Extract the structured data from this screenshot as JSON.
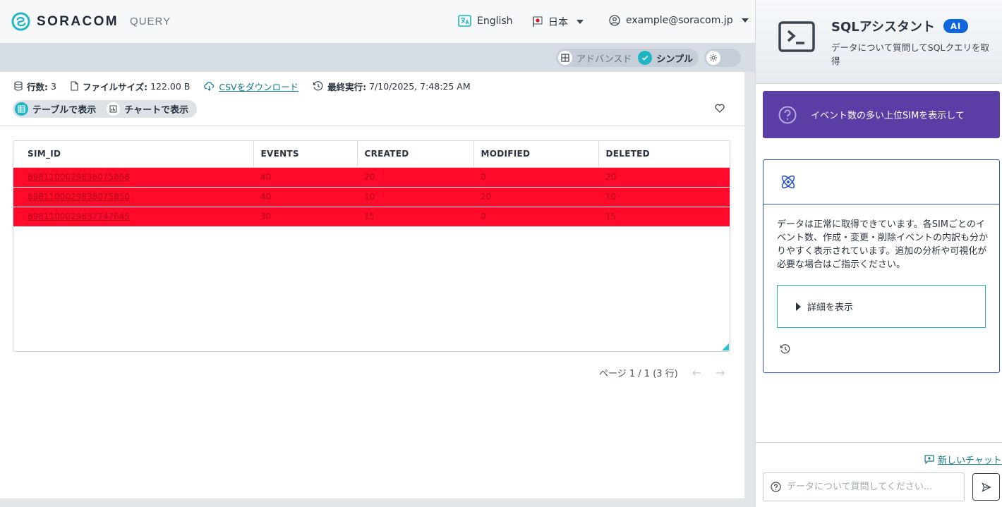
{
  "header": {
    "logo_text": "SORACOM",
    "product": "QUERY",
    "language": "English",
    "region": "日本",
    "account": "example@soracom.jp"
  },
  "mode_toggle": {
    "options": [
      {
        "label": "アドバンスド",
        "active": false
      },
      {
        "label": "シンプル",
        "active": true
      }
    ]
  },
  "result_meta": {
    "rows_label": "行数:",
    "rows_value": "3",
    "size_label": "ファイルサイズ:",
    "size_value": "122.00 B",
    "download_label": "CSVをダウンロード",
    "last_run_label": "最終実行:",
    "last_run_value": "7/10/2025, 7:48:25 AM"
  },
  "view_toggle": {
    "table_label": "テーブルで表示",
    "chart_label": "チャートで表示",
    "selected": "table"
  },
  "table": {
    "columns": [
      "SIM_ID",
      "EVENTS",
      "CREATED",
      "MODIFIED",
      "DELETED"
    ],
    "rows": [
      [
        "8981100029838075868",
        "40",
        "20",
        "0",
        "20"
      ],
      [
        "8981100029838075850",
        "40",
        "10",
        "20",
        "10"
      ],
      [
        "8981100029837747645",
        "30",
        "15",
        "0",
        "15"
      ]
    ],
    "row_highlight_color": "#ff0a2a"
  },
  "pager": {
    "text": "ページ 1 / 1 (3 行)",
    "prev": "←",
    "next": "→"
  },
  "assistant": {
    "title": "SQLアシスタント",
    "badge": "AI",
    "subtitle": "データについて質問してSQLクエリを取得",
    "question": "イベント数の多い上位SIMを表示して",
    "answer": "データは正常に取得できています。各SIMごとのイベント数、作成・変更・削除イベントの内訳も分かりやすく表示されています。追加の分析や可視化が必要な場合はご指示ください。",
    "details_label": "詳細を表示",
    "new_chat_label": "新しいチャット",
    "input_placeholder": "データについて質問してください..."
  },
  "colors": {
    "brand_teal": "#1fb5c2",
    "question_purple": "#5b3ea5",
    "ai_badge_blue": "#1166dd",
    "answer_border": "#2a55c8"
  },
  "icons": [
    "soracom-logo-icon",
    "translate-icon",
    "japan-flag-icon",
    "user-circle-icon",
    "advanced-mode-icon",
    "check-icon",
    "sun-icon",
    "database-icon",
    "file-icon",
    "cloud-download-icon",
    "history-icon",
    "table-icon",
    "chart-icon",
    "heart-icon",
    "terminal-icon",
    "question-icon",
    "atom-icon",
    "new-chat-icon",
    "send-icon"
  ]
}
